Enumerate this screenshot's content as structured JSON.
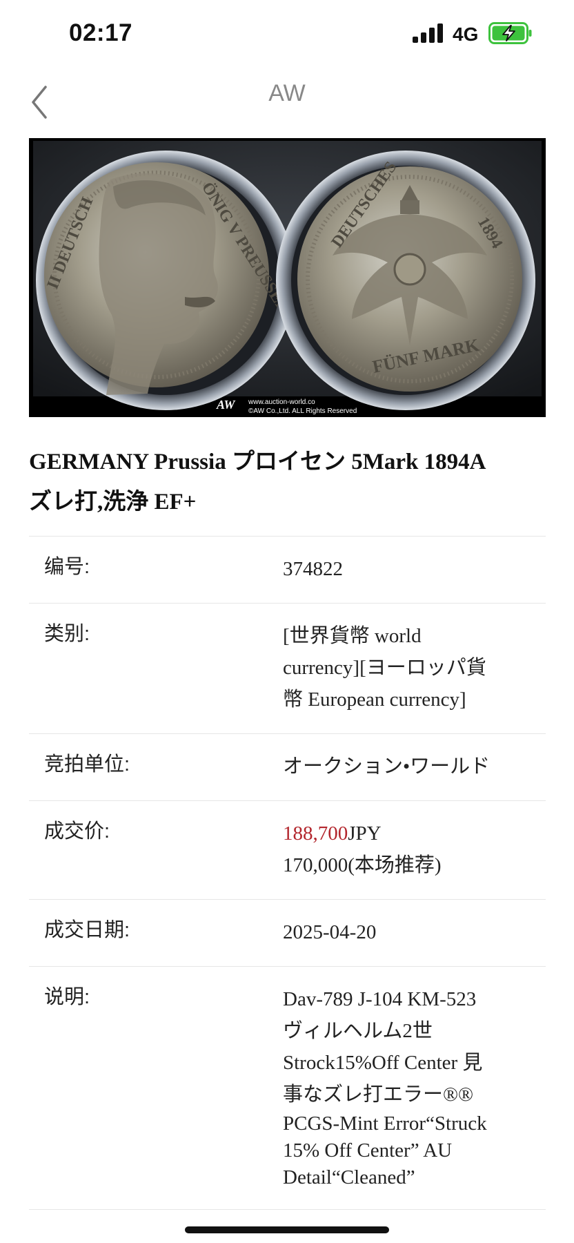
{
  "status_bar": {
    "time": "02:17",
    "network": "4G",
    "battery_color": "#3dc23d"
  },
  "nav": {
    "title": "AW"
  },
  "coin_image": {
    "watermark_url": "www.auction-world.co",
    "watermark_copy": "©AW Co.,Ltd. ALL Rights Reserved",
    "watermark_logo": "AW"
  },
  "title_lines": [
    "GERMANY Prussia プロイセン 5Mark 1894A",
    "ズレ打,洗浄 EF+"
  ],
  "fields": {
    "number": {
      "label": "编号:",
      "value": "374822"
    },
    "category": {
      "label": "类别:",
      "lines": [
        "[世界貨幣 world",
        "currency][ヨーロッパ貨",
        "幣 European currency]"
      ]
    },
    "auction_house": {
      "label": "竞拍单位:",
      "value": "オークション•ワールド"
    },
    "price": {
      "label": "成交价:",
      "amount": "188,700",
      "currency": "JPY",
      "recommend": "170,000(本场推荐)",
      "accent_color": "#b3262d"
    },
    "date": {
      "label": "成交日期:",
      "value": "2025-04-20"
    },
    "description": {
      "label": "说明:",
      "lines": [
        "Dav-789 J-104 KM-523",
        "ヴィルヘルム2世",
        "Strock15%Off Center 見",
        "事なズレ打エラー®®",
        "PCGS-Mint Error“Struck",
        "15% Off Center” AU",
        "Detail“Cleaned”"
      ]
    }
  }
}
